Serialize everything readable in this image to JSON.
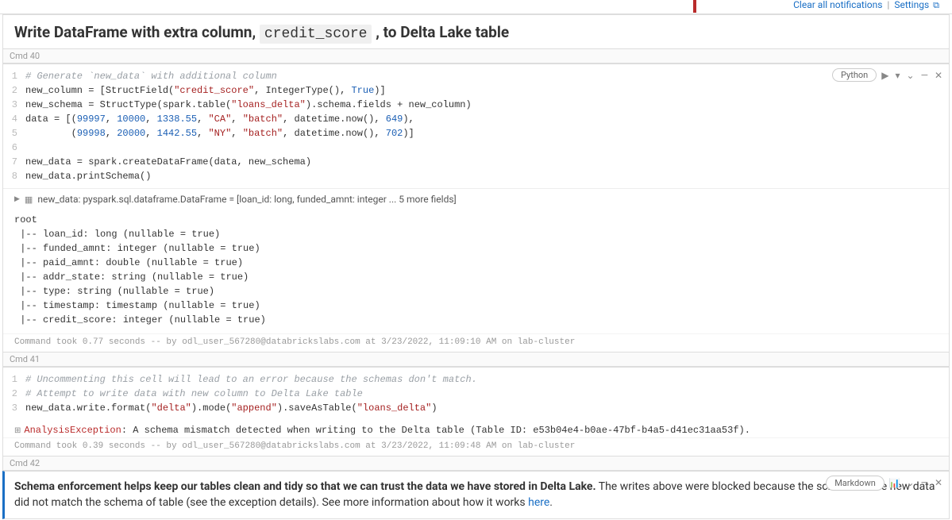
{
  "notification": {
    "clear_label": "Clear all notifications",
    "settings_label": "Settings",
    "ext_icon": "⧉"
  },
  "title_cell": {
    "prefix": "Write DataFrame with extra column, ",
    "code": "credit_score",
    "suffix": " , to Delta Lake table"
  },
  "cmd40_label": "Cmd 40",
  "cmd40": {
    "lang": "Python",
    "gutter": "1\n2\n3\n4\n5\n6\n7\n8",
    "line1_comment": "# Generate `new_data` with additional column",
    "line2_a": "new_column = [StructField(",
    "line2_str1": "\"credit_score\"",
    "line2_b": ", IntegerType(), ",
    "line2_kw": "True",
    "line2_c": ")]",
    "line3_a": "new_schema = StructType(spark.table(",
    "line3_str1": "\"loans_delta\"",
    "line3_b": ").schema.fields + new_column)",
    "line4_a": "data = [(",
    "line4_n1": "99997",
    "line4_c1": ", ",
    "line4_n2": "10000",
    "line4_c2": ", ",
    "line4_n3": "1338.55",
    "line4_c3": ", ",
    "line4_s1": "\"CA\"",
    "line4_c4": ", ",
    "line4_s2": "\"batch\"",
    "line4_c5": ", datetime.now(), ",
    "line4_n4": "649",
    "line4_c6": "),",
    "line5_a": "        (",
    "line5_n1": "99998",
    "line5_c1": ", ",
    "line5_n2": "20000",
    "line5_c2": ", ",
    "line5_n3": "1442.55",
    "line5_c3": ", ",
    "line5_s1": "\"NY\"",
    "line5_c4": ", ",
    "line5_s2": "\"batch\"",
    "line5_c5": ", datetime.now(), ",
    "line5_n4": "702",
    "line5_c6": ")]",
    "line7": "new_data = spark.createDataFrame(data, new_schema)",
    "line8": "new_data.printSchema()",
    "output_meta": "new_data:  pyspark.sql.dataframe.DataFrame = [loan_id: long, funded_amnt: integer ... 5 more fields]",
    "schema_output": "root\n |-- loan_id: long (nullable = true)\n |-- funded_amnt: integer (nullable = true)\n |-- paid_amnt: double (nullable = true)\n |-- addr_state: string (nullable = true)\n |-- type: string (nullable = true)\n |-- timestamp: timestamp (nullable = true)\n |-- credit_score: integer (nullable = true)",
    "status": "Command took 0.77 seconds -- by odl_user_567280@databrickslabs.com at 3/23/2022, 11:09:10 AM on lab-cluster"
  },
  "cmd41_label": "Cmd 41",
  "cmd41": {
    "gutter": "1\n2\n3",
    "line1_comment": "# Uncommenting this cell will lead to an error because the schemas don't match.",
    "line2_comment": "# Attempt to write data with new column to Delta Lake table",
    "line3_a": "new_data.write.format(",
    "line3_s1": "\"delta\"",
    "line3_b": ").mode(",
    "line3_s2": "\"append\"",
    "line3_c": ").saveAsTable(",
    "line3_s3": "\"loans_delta\"",
    "line3_d": ")",
    "err_name": "AnalysisException",
    "err_msg": ": A schema mismatch detected when writing to the Delta table (Table ID: e53b04e4-b0ae-47bf-b4a5-d41ec31aa53f).",
    "status": "Command took 0.39 seconds -- by odl_user_567280@databrickslabs.com at 3/23/2022, 11:09:48 AM on lab-cluster"
  },
  "cmd42_label": "Cmd 42",
  "cmd42": {
    "lang": "Markdown",
    "md_bold": "Schema enforcement helps keep our tables clean and tidy so that we can trust the data we have stored in Delta Lake.",
    "md_rest1": " The writes above were blocked because the schema of the new data did not match the schema of table (see the exception details). See more information about how it works ",
    "md_link": "here",
    "md_rest2": "."
  },
  "icons": {
    "run": "▶",
    "menu_down": "▾",
    "chev_down": "⌄",
    "minus": "—",
    "close": "✕",
    "tri": "▶",
    "tbl": "▦",
    "expand": "⊞",
    "chart": "📊"
  }
}
